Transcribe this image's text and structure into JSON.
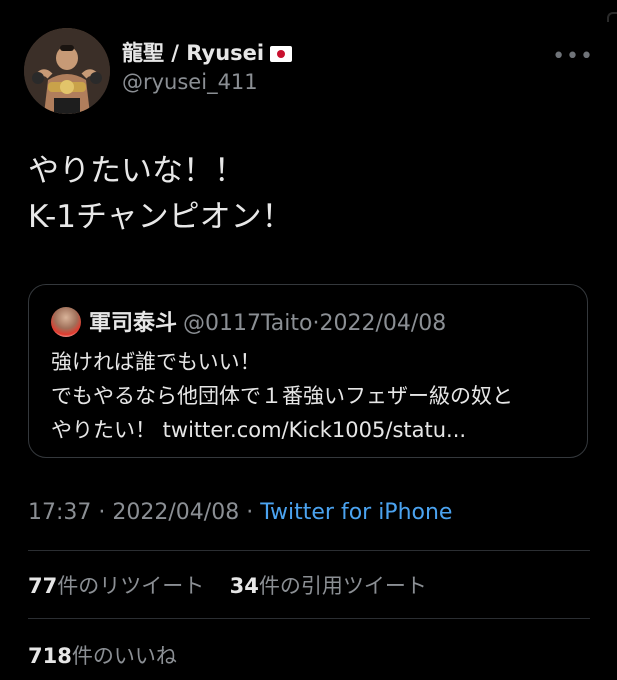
{
  "author": {
    "display_name": "龍聖 / Ryusei",
    "handle": "@ryusei_411",
    "more_icon": "more-horizontal-icon"
  },
  "tweet": {
    "lines": [
      "やりたいな！！",
      "K-1チャンピオン！"
    ]
  },
  "quote": {
    "name": "軍司泰斗",
    "handle": "@0117Taito",
    "separator": "·",
    "date": "2022/04/08",
    "lines": [
      "強ければ誰でもいい！",
      "でもやるなら他団体で１番強いフェザー級の奴と",
      "やりたい！ twitter.com/Kick1005/statu..."
    ]
  },
  "meta": {
    "time": "17:37",
    "separator": "·",
    "date": "2022/04/08",
    "separator2": "·",
    "source": "Twitter for iPhone"
  },
  "stats": {
    "retweets_count": "77",
    "retweets_label": "件のリツイート",
    "quotes_count": "34",
    "quotes_label": "件の引用ツイート",
    "likes_count": "718",
    "likes_label": "件のいいね"
  },
  "colors": {
    "background": "#000000",
    "link": "#4ba3f0",
    "muted": "#8b8f94"
  }
}
